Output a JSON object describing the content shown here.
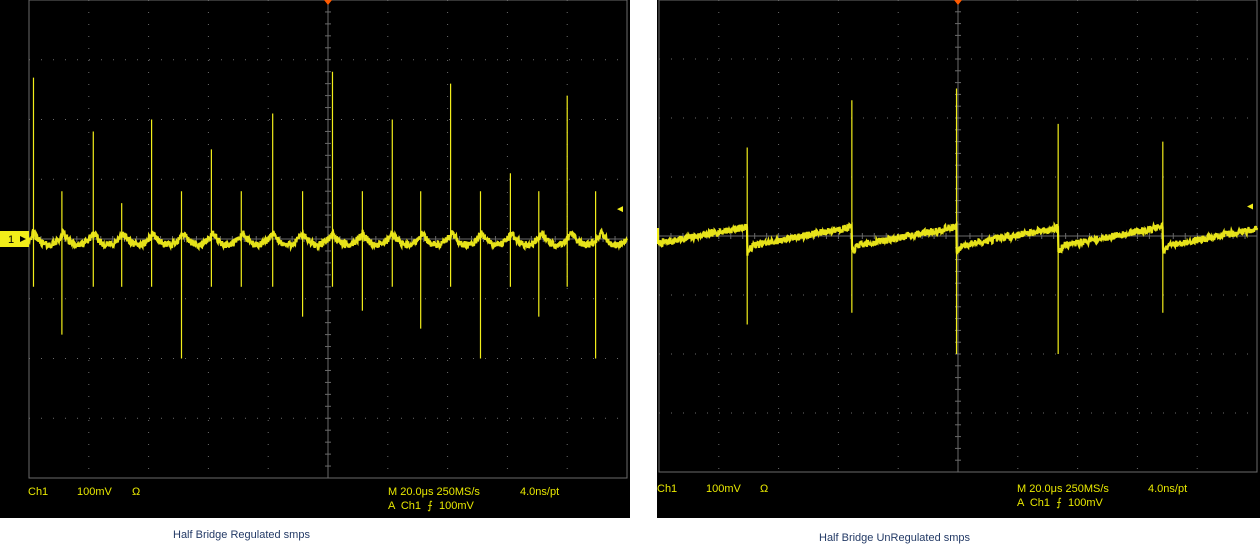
{
  "accent_trace_color": "#f2ee1a",
  "grid_color": "#6a6a6a",
  "trigger_marker_color": "#ff5a00",
  "scopes": [
    {
      "ch_label": "Ch1",
      "ch_scale": "100mV",
      "ch_coupling_symbol": "Ω",
      "timebase": "M 20.0μs 250MS/s",
      "record": "4.0ns/pt",
      "trigger": "A  Ch1  ⨍  100mV",
      "channel_marker": "1",
      "caption": "Half Bridge Regulated smps"
    },
    {
      "ch_label": "Ch1",
      "ch_scale": "100mV",
      "ch_coupling_symbol": "Ω",
      "timebase": "M 20.0μs 250MS/s",
      "record": "4.0ns/pt",
      "trigger": "A  Ch1  ⨍  100mV",
      "channel_marker": "1",
      "caption": "Half Bridge UnRegulated smps"
    }
  ],
  "chart_data": [
    {
      "type": "line",
      "title": "Half Bridge Regulated smps",
      "x_unit": "μs",
      "y_unit": "V",
      "x_divisions": 10,
      "y_divisions": 8,
      "time_per_div_us": 20,
      "volts_per_div": 0.1,
      "xlim": [
        0,
        200
      ],
      "ylim": [
        -0.4,
        0.4
      ],
      "grid": true,
      "ripple_period_us": 20,
      "ripple_pp_V": 0.04,
      "spike_times_us": [
        1.5,
        11.0,
        21.5,
        31.0,
        41.0,
        51.0,
        61.0,
        71.0,
        81.5,
        91.5,
        101.5,
        111.5,
        121.5,
        131.0,
        141.0,
        151.0,
        161.0,
        170.5,
        180.0,
        189.5
      ],
      "spike_peaks_V": [
        0.27,
        -0.16,
        0.18,
        0.06,
        0.2,
        -0.2,
        0.15,
        -0.08,
        0.21,
        -0.13,
        0.28,
        -0.12,
        0.2,
        -0.15,
        0.26,
        -0.2,
        0.11,
        -0.13,
        0.24,
        -0.2
      ]
    },
    {
      "type": "line",
      "title": "Half Bridge UnRegulated smps",
      "x_unit": "μs",
      "y_unit": "V",
      "x_divisions": 10,
      "y_divisions": 8,
      "time_per_div_us": 20,
      "volts_per_div": 0.1,
      "xlim": [
        0,
        200
      ],
      "ylim": [
        -0.4,
        0.4
      ],
      "grid": true,
      "ripple_period_us": 35,
      "ripple_pp_V": 0.045,
      "spike_times_us": [
        29.5,
        64.5,
        99.5,
        133.5,
        168.5
      ],
      "spike_peaks_V": [
        0.15,
        0.23,
        0.25,
        0.19,
        0.16
      ],
      "spike_troughs_V": [
        -0.15,
        -0.13,
        -0.2,
        -0.2,
        -0.13
      ]
    }
  ]
}
